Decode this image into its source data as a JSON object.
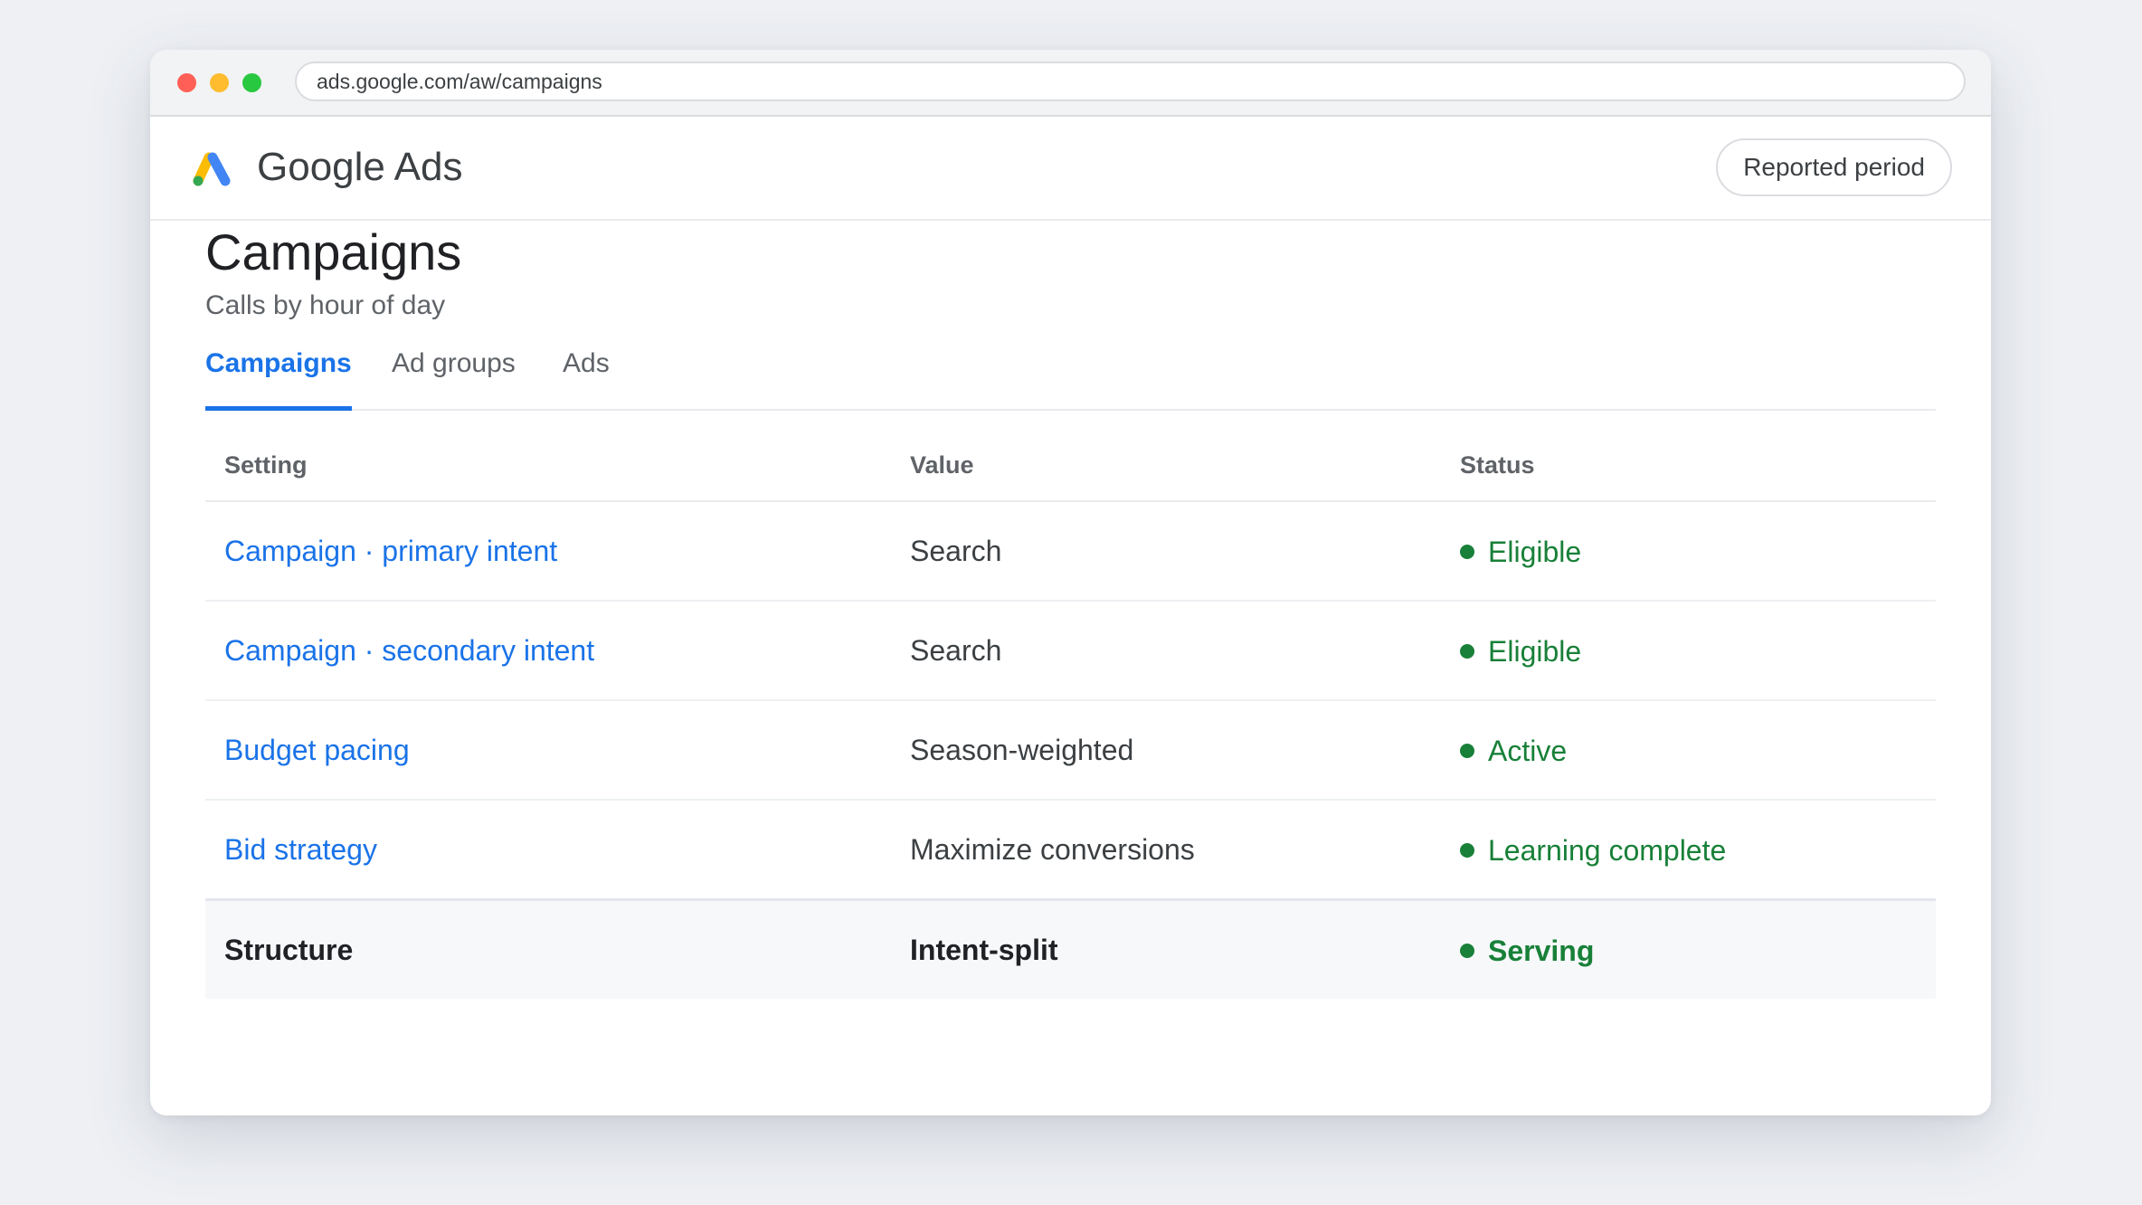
{
  "browser": {
    "url": "ads.google.com/aw/campaigns"
  },
  "app": {
    "brand": "Google Ads",
    "period_button": "Reported period"
  },
  "page": {
    "title": "Campaigns",
    "subtitle": "Calls by hour of day"
  },
  "tabs": [
    {
      "label": "Campaigns",
      "active": true
    },
    {
      "label": "Ad groups",
      "active": false
    },
    {
      "label": "Ads",
      "active": false
    }
  ],
  "table": {
    "headers": [
      "Setting",
      "Value",
      "Status"
    ],
    "rows": [
      {
        "setting": "Campaign · primary intent",
        "value": "Search",
        "status": "Eligible"
      },
      {
        "setting": "Campaign · secondary intent",
        "value": "Search",
        "status": "Eligible"
      },
      {
        "setting": "Budget pacing",
        "value": "Season-weighted",
        "status": "Active"
      },
      {
        "setting": "Bid strategy",
        "value": "Maximize conversions",
        "status": "Learning complete"
      }
    ],
    "summary": {
      "setting": "Structure",
      "value": "Intent-split",
      "status": "Serving"
    }
  },
  "colors": {
    "accent": "#1a73e8",
    "status_ok": "#188038",
    "logo_blue": "#4285f4",
    "logo_yellow": "#fbbc04",
    "logo_green": "#34a853"
  },
  "icons": {
    "logo": "google-ads-logo",
    "status": "status-dot-icon"
  }
}
